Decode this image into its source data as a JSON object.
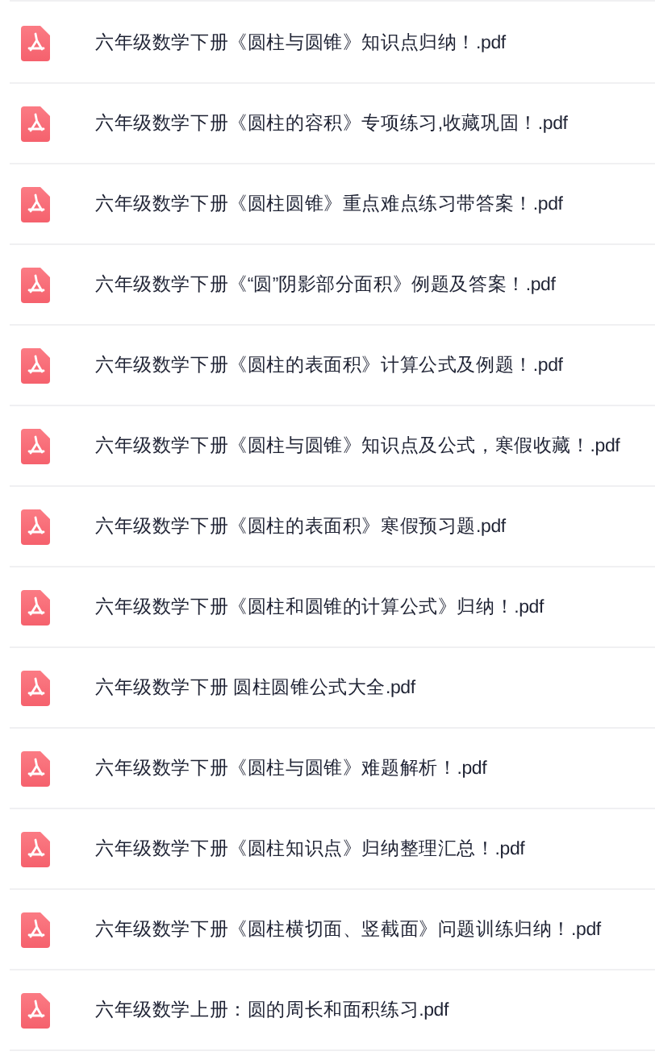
{
  "files": [
    {
      "name": "六年级数学下册《圆柱与圆锥》知识点归纳！.pdf"
    },
    {
      "name": "六年级数学下册《圆柱的容积》专项练习,收藏巩固！.pdf"
    },
    {
      "name": "六年级数学下册《圆柱圆锥》重点难点练习带答案！.pdf"
    },
    {
      "name": "六年级数学下册《“圆”阴影部分面积》例题及答案！.pdf"
    },
    {
      "name": "六年级数学下册《圆柱的表面积》计算公式及例题！.pdf"
    },
    {
      "name": "六年级数学下册《圆柱与圆锥》知识点及公式，寒假收藏！.pdf"
    },
    {
      "name": "六年级数学下册《圆柱的表面积》寒假预习题.pdf"
    },
    {
      "name": "六年级数学下册《圆柱和圆锥的计算公式》归纳！.pdf"
    },
    {
      "name": "六年级数学下册 圆柱圆锥公式大全.pdf"
    },
    {
      "name": "六年级数学下册《圆柱与圆锥》难题解析！.pdf"
    },
    {
      "name": "六年级数学下册《圆柱知识点》归纳整理汇总！.pdf"
    },
    {
      "name": "六年级数学下册《圆柱横切面、竖截面》问题训练归纳！.pdf"
    },
    {
      "name": "六年级数学上册：圆的周长和面积练习.pdf"
    }
  ]
}
